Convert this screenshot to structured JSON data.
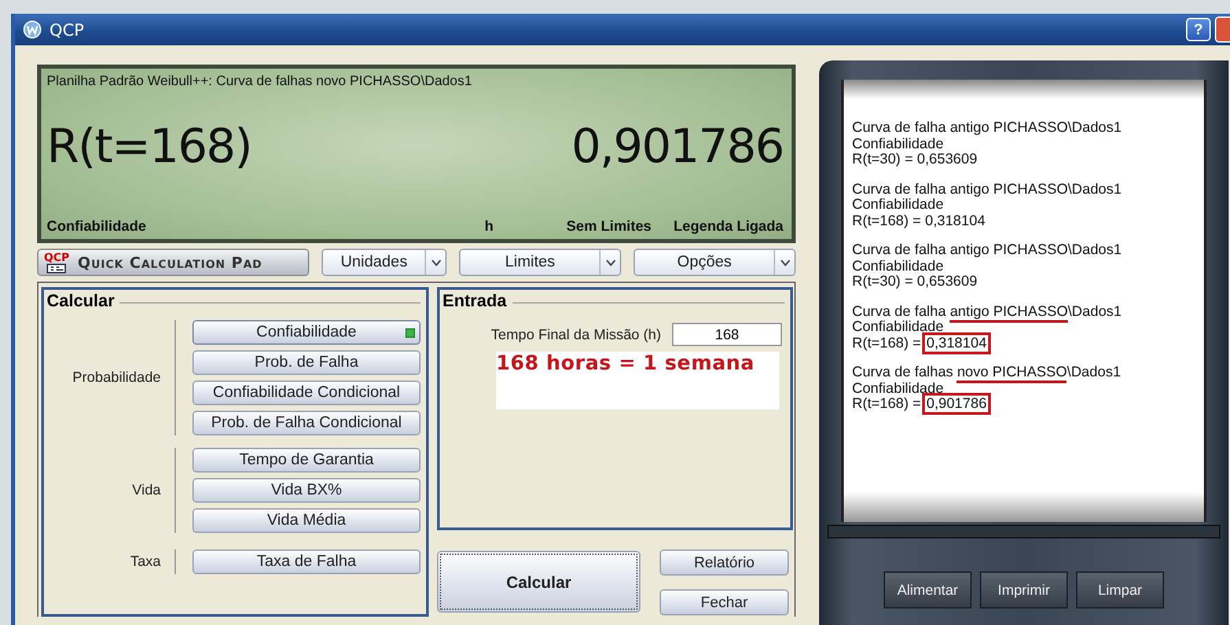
{
  "window": {
    "title": "QCP",
    "controls": [
      "?"
    ]
  },
  "display": {
    "source": "Planilha Padrão Weibull++: Curva de falhas novo PICHASSO\\Dados1",
    "expression": "R(t=168)",
    "result": "0,901786",
    "status": [
      "Confiabilidade",
      "h",
      "Sem Limites",
      "Legenda Ligada"
    ]
  },
  "toolbar": {
    "pad_button": {
      "logo": "QCP",
      "label": "Quick Calculation Pad"
    },
    "dropdowns": [
      "Unidades",
      "Limites",
      "Opções"
    ]
  },
  "calcular": {
    "title": "Calcular",
    "groups": [
      {
        "label": "Probabilidade",
        "buttons": [
          {
            "label": "Confiabilidade",
            "selected": true
          },
          {
            "label": "Prob. de Falha",
            "selected": false
          },
          {
            "label": "Confiabilidade Condicional",
            "selected": false
          },
          {
            "label": "Prob. de Falha Condicional",
            "selected": false
          }
        ]
      },
      {
        "label": "Vida",
        "buttons": [
          {
            "label": "Tempo de Garantia",
            "selected": false
          },
          {
            "label": "Vida BX%",
            "selected": false
          },
          {
            "label": "Vida Média",
            "selected": false
          }
        ]
      },
      {
        "label": "Taxa",
        "buttons": [
          {
            "label": "Taxa de Falha",
            "selected": false
          }
        ]
      }
    ]
  },
  "entrada": {
    "title": "Entrada",
    "field_label": "Tempo Final da Missão (h)",
    "field_value": "168",
    "note": "168 horas = 1 semana"
  },
  "actions": {
    "calculate": "Calcular",
    "report": "Relatório",
    "close": "Fechar"
  },
  "tape": {
    "entries": [
      {
        "source": [
          {
            "text": "Curva de falha antigo PICHASSO\\Dados1",
            "underlined": false
          }
        ],
        "measure": "Confiabilidade",
        "expression": "R(t=30) = ",
        "value": "0,653609",
        "value_boxed": false
      },
      {
        "source": [
          {
            "text": "Curva de falha antigo PICHASSO\\Dados1",
            "underlined": false
          }
        ],
        "measure": "Confiabilidade",
        "expression": "R(t=168) = ",
        "value": "0,318104",
        "value_boxed": false
      },
      {
        "source": [
          {
            "text": "Curva de falha antigo PICHASSO\\Dados1",
            "underlined": false
          }
        ],
        "measure": "Confiabilidade",
        "expression": "R(t=30) = ",
        "value": "0,653609",
        "value_boxed": false
      },
      {
        "source": [
          {
            "text": "Curva de falha ",
            "underlined": false
          },
          {
            "text": "antigo PICHASSO",
            "underlined": true
          },
          {
            "text": "\\Dados1",
            "underlined": false
          }
        ],
        "measure": "Confiabilidade",
        "expression": "R(t=168) = ",
        "value": "0,318104",
        "value_boxed": true
      },
      {
        "source": [
          {
            "text": "Curva de falhas ",
            "underlined": false
          },
          {
            "text": "novo PICHASSO",
            "underlined": true
          },
          {
            "text": "\\Dados1",
            "underlined": false
          }
        ],
        "measure": "Confiabilidade",
        "expression": "R(t=168) = ",
        "value": "0,901786",
        "value_boxed": true
      }
    ],
    "buttons": [
      "Alimentar",
      "Imprimir",
      "Limpar"
    ]
  }
}
